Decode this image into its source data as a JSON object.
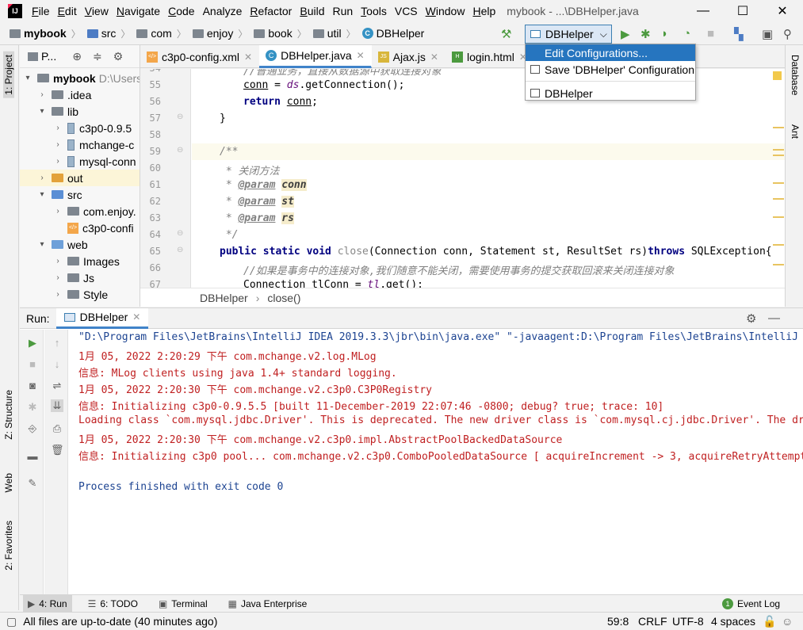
{
  "titlebar": {
    "logo_text": "IJ",
    "menu": [
      "File",
      "Edit",
      "View",
      "Navigate",
      "Code",
      "Analyze",
      "Refactor",
      "Build",
      "Run",
      "Tools",
      "VCS",
      "Window",
      "Help"
    ],
    "window_title": "mybook - ...\\DBHelper.java",
    "minimize": "—",
    "maximize": "☐",
    "close": "✕"
  },
  "navbar": {
    "crumbs": [
      "mybook",
      "src",
      "com",
      "enjoy",
      "book",
      "util",
      "DBHelper"
    ],
    "run_config": "DBHelper",
    "chevron": "⌵"
  },
  "popup": {
    "items": [
      "Edit Configurations...",
      "Save 'DBHelper' Configuration",
      "DBHelper"
    ]
  },
  "left_strip": {
    "project": "1: Project",
    "structure": "Z: Structure",
    "web": "Web",
    "favorites": "2: Favorites"
  },
  "right_strip": {
    "database": "Database",
    "ant": "Ant"
  },
  "project_panel": {
    "header": "P...",
    "tree": [
      {
        "label": "mybook",
        "extra": "D:\\Users"
      },
      {
        "label": ".idea"
      },
      {
        "label": "lib"
      },
      {
        "label": "c3p0-0.9.5"
      },
      {
        "label": "mchange-c"
      },
      {
        "label": "mysql-conn"
      },
      {
        "label": "out"
      },
      {
        "label": "src"
      },
      {
        "label": "com.enjoy."
      },
      {
        "label": "c3p0-confi"
      },
      {
        "label": "web"
      },
      {
        "label": "Images"
      },
      {
        "label": "Js"
      },
      {
        "label": "Style"
      }
    ]
  },
  "tabs": [
    {
      "label": "c3p0-config.xml",
      "icon": "xml"
    },
    {
      "label": "DBHelper.java",
      "icon": "C"
    },
    {
      "label": "Ajax.js",
      "icon": "JS"
    },
    {
      "label": "login.html",
      "icon": "H"
    }
  ],
  "editor": {
    "line_numbers": [
      "54",
      "55",
      "56",
      "57",
      "58",
      "59",
      "60",
      "61",
      "62",
      "63",
      "64",
      "65",
      "66",
      "67"
    ],
    "comment_top": "//普通业务，直接从数据源中获取连接对象",
    "line55a": "conn",
    "line55b": " = ",
    "line55c": "ds",
    "line55d": ".getConnection();",
    "line56a": "return ",
    "line56b": "conn",
    "line56c": ";",
    "line57": "}",
    "line59": "/**",
    "line60": " * 关闭方法",
    "param_tag": "@param",
    "p1": "conn",
    "p2": "st",
    "p3": "rs",
    "line64": " */",
    "line65a": "public static void ",
    "line65b": "close",
    "line65c": "(Connection conn, Statement st, ResultSet rs)",
    "line65d": "throws",
    "line65e": " SQLException{",
    "line66": "//如果是事务中的连接对象,我们随意不能关闭，需要使用事务的提交获取回滚来关闭连接对象",
    "line67a": "Connection tlConn = ",
    "line67b": "tl",
    "line67c": ".get();"
  },
  "code_breadcrumb": {
    "cls": "DBHelper",
    "sep": "›",
    "method": "close()"
  },
  "run_panel": {
    "label": "Run:",
    "tab": "DBHelper",
    "output": [
      {
        "text": "\"D:\\Program Files\\JetBrains\\IntelliJ IDEA 2019.3.3\\jbr\\bin\\java.exe\" \"-javaagent:D:\\Program Files\\JetBrains\\IntelliJ",
        "cls": "blue"
      },
      {
        "text": "1月 05, 2022 2:20:29 下午 com.mchange.v2.log.MLog",
        "cls": "red"
      },
      {
        "text": "信息: MLog clients using java 1.4+ standard logging.",
        "cls": "red"
      },
      {
        "text": "1月 05, 2022 2:20:30 下午 com.mchange.v2.c3p0.C3P0Registry",
        "cls": "red"
      },
      {
        "text": "信息: Initializing c3p0-0.9.5.5 [built 11-December-2019 22:07:46 -0800; debug? true; trace: 10]",
        "cls": "red"
      },
      {
        "text": "Loading class `com.mysql.jdbc.Driver'. This is deprecated. The new driver class is `com.mysql.cj.jdbc.Driver'. The dr",
        "cls": "red"
      },
      {
        "text": "1月 05, 2022 2:20:30 下午 com.mchange.v2.c3p0.impl.AbstractPoolBackedDataSource",
        "cls": "red"
      },
      {
        "text": "信息: Initializing c3p0 pool... com.mchange.v2.c3p0.ComboPooledDataSource [ acquireIncrement -> 3, acquireRetryAttempt",
        "cls": "red"
      },
      {
        "text": "",
        "cls": "blue"
      },
      {
        "text": "Process finished with exit code 0",
        "cls": "blue"
      }
    ]
  },
  "bottom_tabs": {
    "run": "4: Run",
    "todo": "6: TODO",
    "terminal": "Terminal",
    "java_enterprise": "Java Enterprise",
    "event_log": "Event Log",
    "event_count": "1"
  },
  "statusbar": {
    "message": "All files are up-to-date (40 minutes ago)",
    "position": "59:8",
    "line_sep": "CRLF",
    "encoding": "UTF-8",
    "indent": "4 spaces"
  }
}
